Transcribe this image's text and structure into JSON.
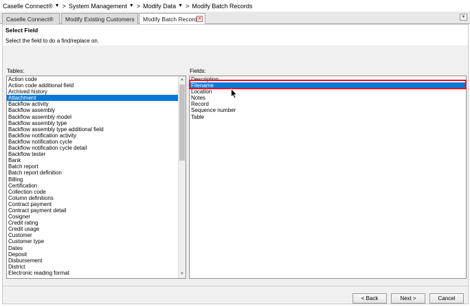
{
  "breadcrumb": {
    "items": [
      "Caselle Connect®",
      "System Management",
      "Modify Data",
      "Modify Batch Records"
    ],
    "separator": ">"
  },
  "tabs": [
    {
      "label": "Caselle Connect®"
    },
    {
      "label": "Modify Existing Customers"
    },
    {
      "label": "Modify Batch Records",
      "active": true
    }
  ],
  "page": {
    "title": "Select Field",
    "instruction": "Select the field to do a find/replace on."
  },
  "tables": {
    "label": "Tables:",
    "selected": "Attachment",
    "items": [
      "Action code",
      "Action code additional field",
      "Archived history",
      "Attachment",
      "Backflow activity",
      "Backflow assembly",
      "Backflow assembly model",
      "Backflow assembly type",
      "Backflow assembly type additional field",
      "Backflow notification activity",
      "Backflow notification cycle",
      "Backflow notification cycle detail",
      "Backflow tester",
      "Bank",
      "Batch report",
      "Batch report definition",
      "Billing",
      "Certification",
      "Collection code",
      "Column definitions",
      "Contract payment",
      "Contract payment detail",
      "Cosigner",
      "Credit rating",
      "Credit usage",
      "Customer",
      "Customer type",
      "Dates",
      "Deposit",
      "Disbursement",
      "District",
      "Electronic reading format"
    ]
  },
  "fields": {
    "label": "Fields:",
    "selected": "Filename",
    "items": [
      "Description",
      "Filename",
      "Location",
      "Notes",
      "Record",
      "Sequence number",
      "Table"
    ]
  },
  "buttons": {
    "back": "< Back",
    "next": "Next >",
    "cancel": "Cancel"
  },
  "colors": {
    "selection": "#0a78d7",
    "highlight_box": "#e81123"
  }
}
